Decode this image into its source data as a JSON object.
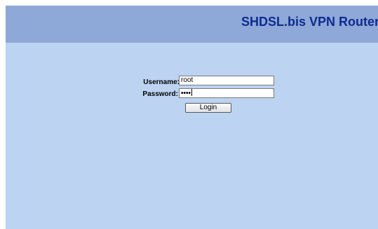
{
  "header": {
    "title": "SHDSL.bis VPN Router"
  },
  "login_form": {
    "username_label": "Username:",
    "username_value": "root",
    "password_label": "Password:",
    "password_masked": "••••",
    "login_button_label": "Login"
  },
  "colors": {
    "page_background": "#bcd3f2",
    "header_background": "#8ea8d8",
    "title_color": "#0d2c8f"
  }
}
